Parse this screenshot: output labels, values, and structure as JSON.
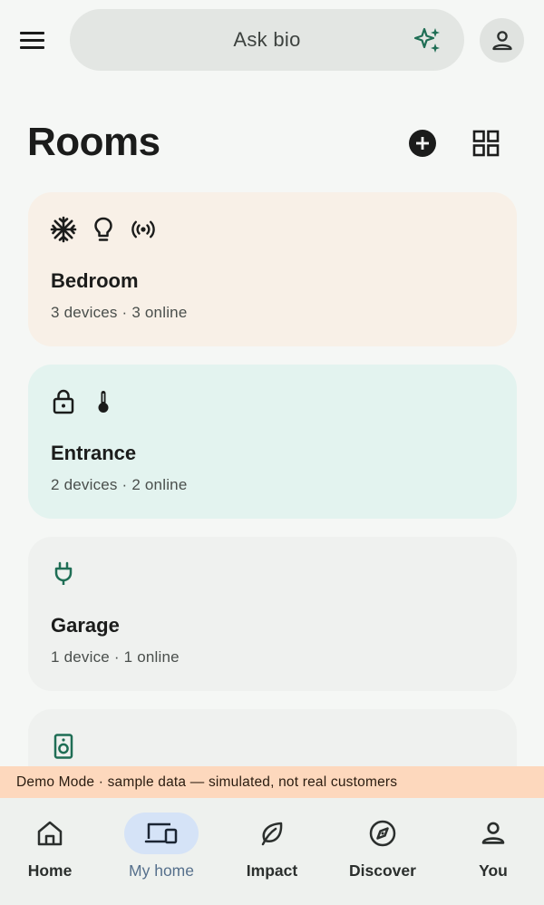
{
  "header": {
    "search_label": "Ask bio",
    "icons": {
      "menu": "menu-icon",
      "sparkle": "sparkle-icon",
      "account": "person-icon"
    }
  },
  "page": {
    "title": "Rooms",
    "actions": [
      {
        "name": "add-room",
        "icon": "add-circle-icon"
      },
      {
        "name": "grid-view",
        "icon": "grid-view-icon"
      }
    ]
  },
  "rooms": [
    {
      "name": "Bedroom",
      "meta": "3 devices · 3 online",
      "bg": "#f8f0e7",
      "icons": [
        "snowflake-icon",
        "lightbulb-icon",
        "sensor-icon"
      ]
    },
    {
      "name": "Entrance",
      "meta": "2 devices · 2 online",
      "bg": "#e3f3ef",
      "icons": [
        "lock-icon",
        "thermometer-icon"
      ]
    },
    {
      "name": "Garage",
      "meta": "1 device · 1 online",
      "bg": "#eff1ef",
      "icons": [
        "plug-icon"
      ]
    },
    {
      "name": "",
      "meta": "",
      "bg": "#eff1ef",
      "icons": [
        "speaker-icon"
      ]
    }
  ],
  "banner": {
    "text": "Demo Mode · sample data — simulated, not real customers"
  },
  "nav": {
    "active": "My home",
    "items": [
      {
        "label": "Home",
        "icon": "home-icon"
      },
      {
        "label": "My home",
        "icon": "devices-icon"
      },
      {
        "label": "Impact",
        "icon": "leaf-icon"
      },
      {
        "label": "Discover",
        "icon": "compass-icon"
      },
      {
        "label": "You",
        "icon": "person-icon"
      }
    ]
  },
  "colors": {
    "accent": "#1f6e55",
    "active_pill": "#d5e3f7",
    "banner": "#fdd8bd"
  }
}
